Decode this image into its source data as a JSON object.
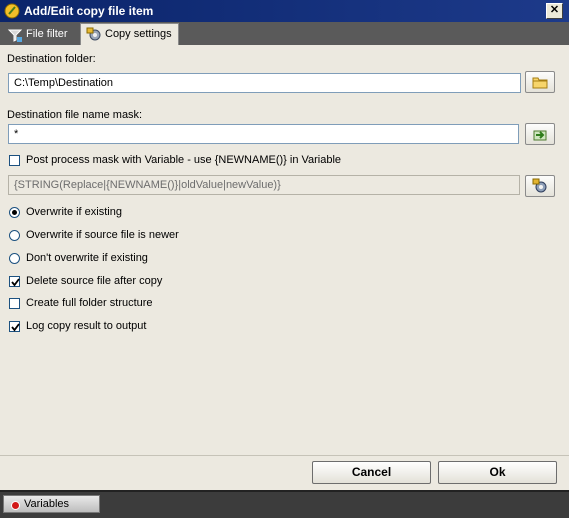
{
  "window": {
    "title": "Add/Edit copy file item",
    "close_glyph": "✕"
  },
  "tabs": [
    {
      "label": "File filter",
      "icon": "filter-icon",
      "active": false
    },
    {
      "label": "Copy settings",
      "icon": "settings-icon",
      "active": true
    }
  ],
  "form": {
    "destination_folder_label": "Destination folder:",
    "destination_folder_value": "C:\\Temp\\Destination",
    "mask_label": "Destination file name mask:",
    "mask_value": "*",
    "post_process_label": "Post process mask with Variable - use {NEWNAME()} in Variable",
    "post_process_checked": false,
    "variable_expression": "{STRING(Replace|{NEWNAME()}|oldValue|newValue)}",
    "options": {
      "overwrite_if_existing": {
        "label": "Overwrite if existing",
        "selected": true
      },
      "overwrite_if_newer": {
        "label": "Overwrite if source file is newer",
        "selected": false
      },
      "dont_overwrite": {
        "label": "Don't overwrite if existing",
        "selected": false
      }
    },
    "delete_source": {
      "label": "Delete source file after copy",
      "checked": true
    },
    "full_folder_structure": {
      "label": "Create full folder structure",
      "checked": false
    },
    "log_result": {
      "label": "Log copy result to output",
      "checked": true
    }
  },
  "buttons": {
    "cancel": "Cancel",
    "ok": "Ok"
  },
  "statusbar": {
    "variables_label": "Variables"
  },
  "colors": {
    "title_bar": "#0a246a",
    "panel": "#ece9e0",
    "tab_strip": "#5a5a5a",
    "status_strip": "#3c3c3c"
  }
}
